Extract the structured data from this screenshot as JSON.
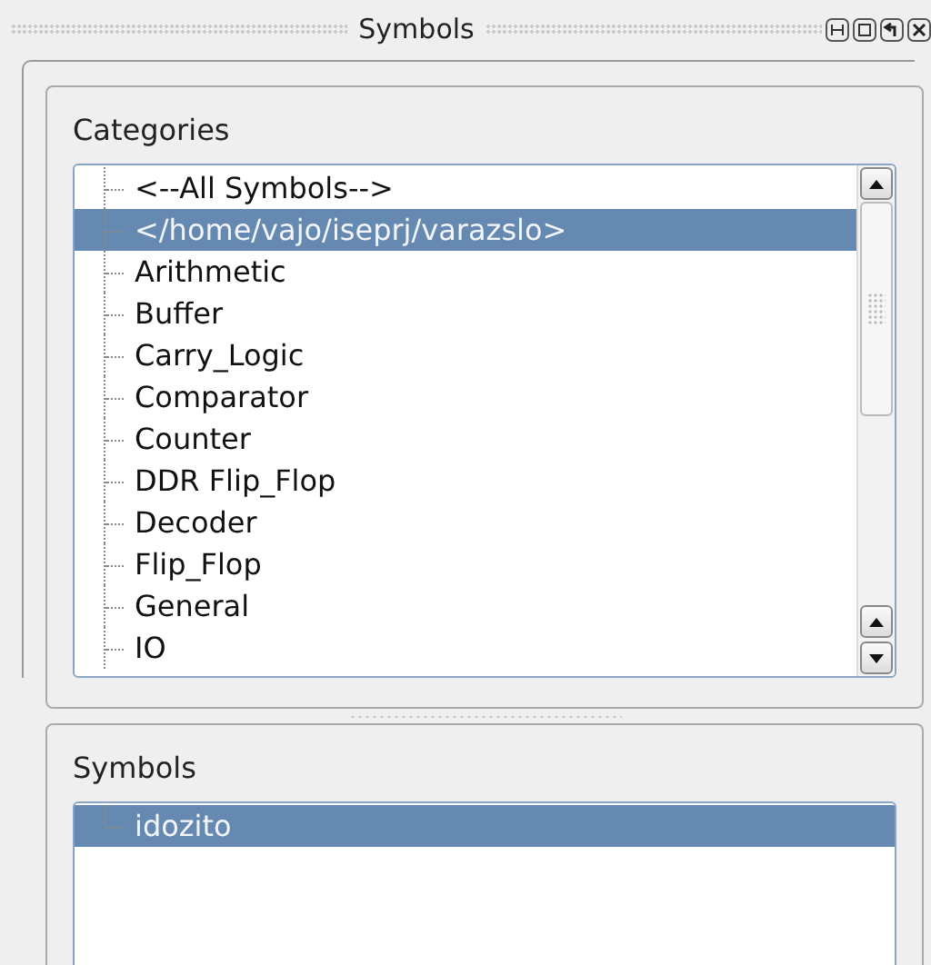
{
  "window": {
    "title": "Symbols"
  },
  "categories": {
    "label": "Categories",
    "items": [
      {
        "label": "<--All Symbols-->",
        "selected": false
      },
      {
        "label": "</home/vajo/iseprj/varazslo>",
        "selected": true
      },
      {
        "label": "Arithmetic",
        "selected": false
      },
      {
        "label": "Buffer",
        "selected": false
      },
      {
        "label": "Carry_Logic",
        "selected": false
      },
      {
        "label": "Comparator",
        "selected": false
      },
      {
        "label": "Counter",
        "selected": false
      },
      {
        "label": "DDR Flip_Flop",
        "selected": false
      },
      {
        "label": "Decoder",
        "selected": false
      },
      {
        "label": "Flip_Flop",
        "selected": false
      },
      {
        "label": "General",
        "selected": false
      },
      {
        "label": "IO",
        "selected": false
      }
    ]
  },
  "symbols": {
    "label": "Symbols",
    "items": [
      {
        "label": "idozito",
        "selected": true
      }
    ]
  }
}
